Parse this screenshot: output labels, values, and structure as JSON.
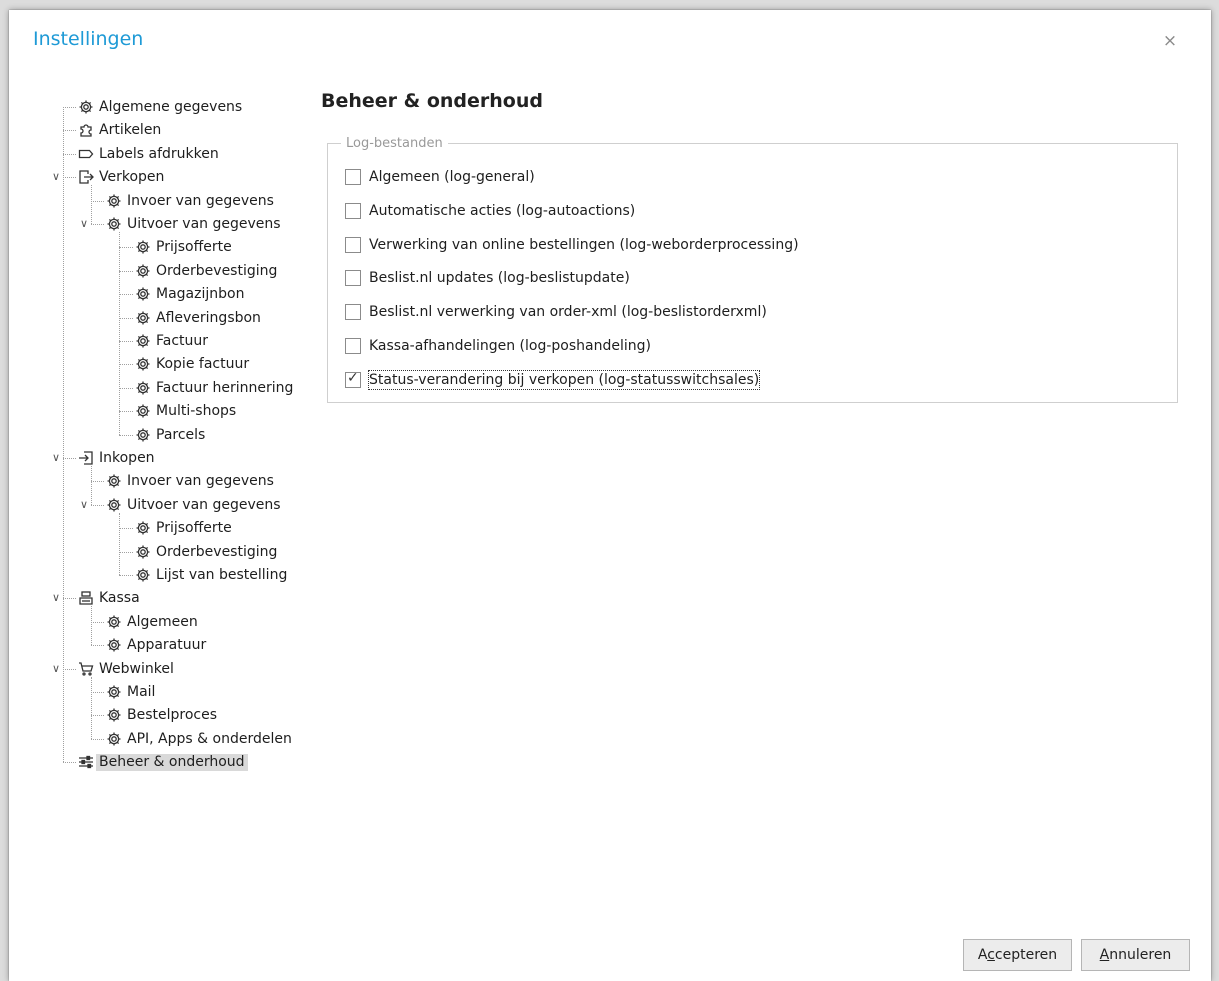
{
  "dialog": {
    "title": "Instellingen",
    "close_glyph": "×"
  },
  "tree": {
    "items": [
      {
        "label": "Algemene gegevens",
        "icon": "gear-icon",
        "level": 0
      },
      {
        "label": "Artikelen",
        "icon": "puzzle-icon",
        "level": 0
      },
      {
        "label": "Labels afdrukken",
        "icon": "label-icon",
        "level": 0
      },
      {
        "label": "Verkopen",
        "icon": "export-icon",
        "level": 0,
        "expanded": true
      },
      {
        "label": "Invoer van gegevens",
        "icon": "gear-icon",
        "level": 1
      },
      {
        "label": "Uitvoer van gegevens",
        "icon": "gear-icon",
        "level": 1,
        "expanded": true
      },
      {
        "label": "Prijsofferte",
        "icon": "gear-icon",
        "level": 2
      },
      {
        "label": "Orderbevestiging",
        "icon": "gear-icon",
        "level": 2
      },
      {
        "label": "Magazijnbon",
        "icon": "gear-icon",
        "level": 2
      },
      {
        "label": "Afleveringsbon",
        "icon": "gear-icon",
        "level": 2
      },
      {
        "label": "Factuur",
        "icon": "gear-icon",
        "level": 2
      },
      {
        "label": "Kopie factuur",
        "icon": "gear-icon",
        "level": 2
      },
      {
        "label": "Factuur herinnering",
        "icon": "gear-icon",
        "level": 2
      },
      {
        "label": "Multi-shops",
        "icon": "gear-icon",
        "level": 2
      },
      {
        "label": "Parcels",
        "icon": "gear-icon",
        "level": 2
      },
      {
        "label": "Inkopen",
        "icon": "import-icon",
        "level": 0,
        "expanded": true
      },
      {
        "label": "Invoer van gegevens",
        "icon": "gear-icon",
        "level": 1
      },
      {
        "label": "Uitvoer van gegevens",
        "icon": "gear-icon",
        "level": 1,
        "expanded": true
      },
      {
        "label": "Prijsofferte",
        "icon": "gear-icon",
        "level": 2
      },
      {
        "label": "Orderbevestiging",
        "icon": "gear-icon",
        "level": 2
      },
      {
        "label": "Lijst van bestelling",
        "icon": "gear-icon",
        "level": 2
      },
      {
        "label": "Kassa",
        "icon": "register-icon",
        "level": 0,
        "expanded": true
      },
      {
        "label": "Algemeen",
        "icon": "gear-icon",
        "level": 1
      },
      {
        "label": "Apparatuur",
        "icon": "gear-icon",
        "level": 1
      },
      {
        "label": "Webwinkel",
        "icon": "cart-icon",
        "level": 0,
        "expanded": true
      },
      {
        "label": "Mail",
        "icon": "gear-icon",
        "level": 1
      },
      {
        "label": "Bestelproces",
        "icon": "gear-icon",
        "level": 1
      },
      {
        "label": "API, Apps & onderdelen",
        "icon": "gear-icon",
        "level": 1
      },
      {
        "label": "Beheer & onderhoud",
        "icon": "sliders-icon",
        "level": 0,
        "selected": true
      }
    ]
  },
  "panel": {
    "title": "Beheer & onderhoud",
    "group_legend": "Log-bestanden",
    "checkboxes": [
      {
        "label": "Algemeen (log-general)",
        "checked": false
      },
      {
        "label": "Automatische acties (log-autoactions)",
        "checked": false
      },
      {
        "label": "Verwerking van online bestellingen (log-weborderprocessing)",
        "checked": false
      },
      {
        "label": "Beslist.nl updates (log-beslistupdate)",
        "checked": false
      },
      {
        "label": "Beslist.nl verwerking van order-xml (log-beslistorderxml)",
        "checked": false
      },
      {
        "label": "Kassa-afhandelingen (log-poshandeling)",
        "checked": false
      },
      {
        "label": "Status-verandering bij verkopen (log-statusswitchsales)",
        "checked": true
      }
    ]
  },
  "buttons": {
    "accept": {
      "pre": "A",
      "mnemonic": "c",
      "post": "cepteren"
    },
    "cancel": {
      "pre": "",
      "mnemonic": "A",
      "post": "nnuleren"
    }
  }
}
